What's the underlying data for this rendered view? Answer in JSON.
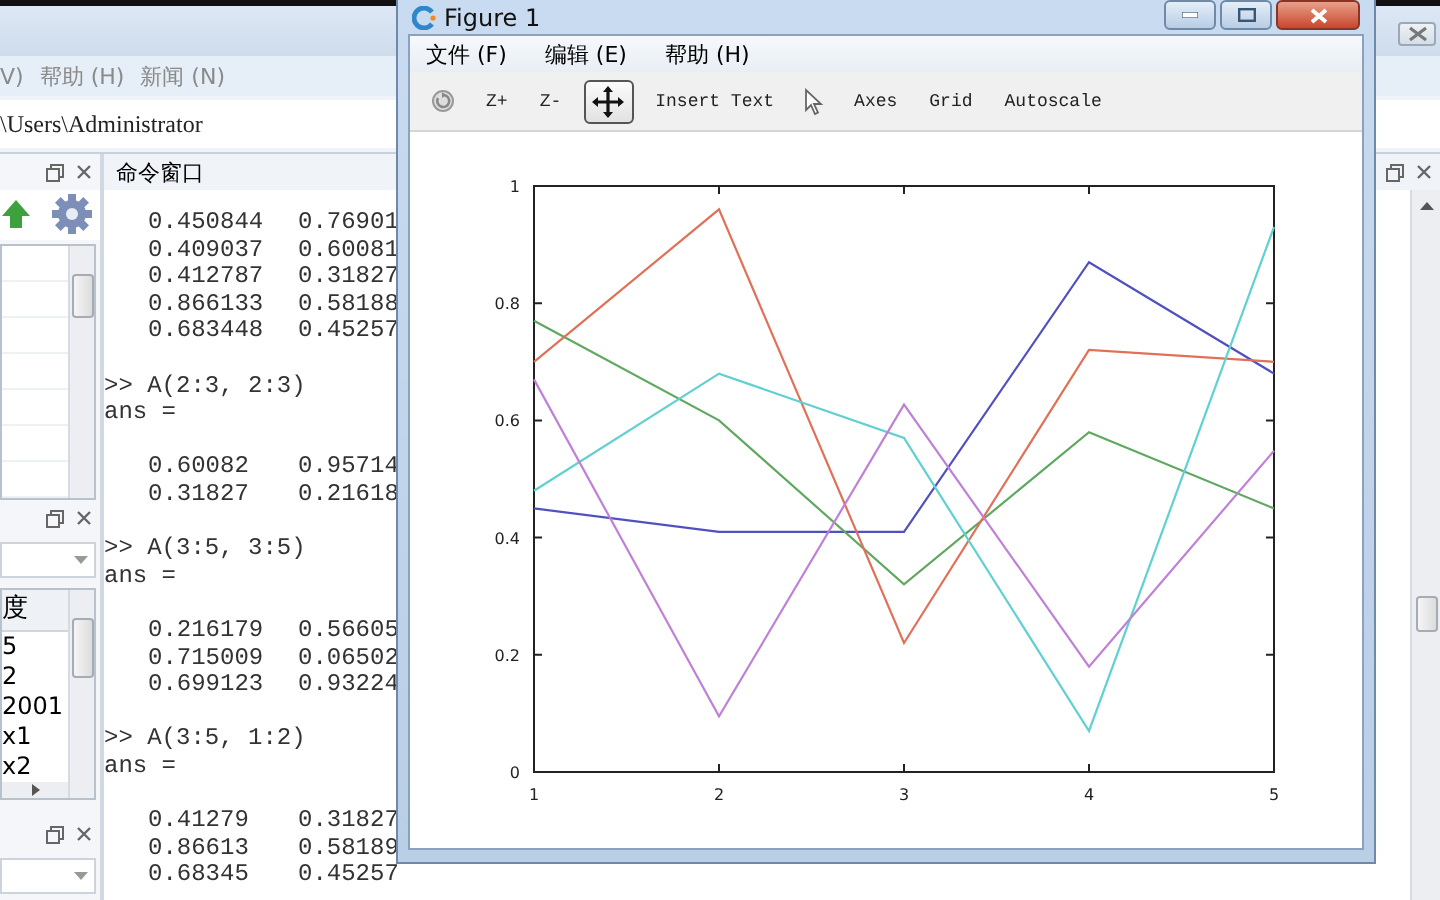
{
  "main_window": {
    "menu": [
      "V)",
      "帮助 (H)",
      "新闻 (N)"
    ],
    "path": "\\Users\\Administrator",
    "variable_table": {
      "header": "度",
      "rows": [
        "5",
        "2",
        "2001",
        "x1",
        "x2"
      ]
    },
    "command_window": {
      "title": "命令窗口",
      "blocks": [
        {
          "rows": [
            [
              "0.450844",
              "0.76901"
            ],
            [
              "0.409037",
              "0.60081"
            ],
            [
              "0.412787",
              "0.31827"
            ],
            [
              "0.866133",
              "0.58188"
            ],
            [
              "0.683448",
              "0.45257"
            ]
          ]
        },
        {
          "prompt": ">> A(2:3, 2:3)",
          "result": "ans =",
          "rows": [
            [
              "0.60082",
              "0.95714"
            ],
            [
              "0.31827",
              "0.21618"
            ]
          ]
        },
        {
          "prompt": ">> A(3:5, 3:5)",
          "result": "ans =",
          "rows": [
            [
              "0.216179",
              "0.56605"
            ],
            [
              "0.715009",
              "0.06502"
            ],
            [
              "0.699123",
              "0.93224"
            ]
          ]
        },
        {
          "prompt": ">> A(3:5, 1:2)",
          "result": "ans =",
          "rows": [
            [
              "0.41279",
              "0.31827"
            ],
            [
              "0.86613",
              "0.58189"
            ],
            [
              "0.68345",
              "0.45257"
            ]
          ]
        }
      ]
    }
  },
  "figure": {
    "title": "Figure 1",
    "menu": [
      "文件 (F)",
      "编辑 (E)",
      "帮助 (H)"
    ],
    "toolbar": [
      {
        "kind": "rotate",
        "selected": false
      },
      {
        "kind": "text",
        "label": "Z+",
        "selected": false
      },
      {
        "kind": "text",
        "label": "Z-",
        "selected": false
      },
      {
        "kind": "pan",
        "selected": true
      },
      {
        "kind": "text",
        "label": "Insert Text",
        "selected": false
      },
      {
        "kind": "select",
        "selected": false
      },
      {
        "kind": "text",
        "label": "Axes",
        "selected": false
      },
      {
        "kind": "text",
        "label": "Grid",
        "selected": false
      },
      {
        "kind": "text",
        "label": "Autoscale",
        "selected": false
      }
    ],
    "chart_data": {
      "type": "line",
      "x": [
        1,
        2,
        3,
        4,
        5
      ],
      "xlim": [
        1,
        5
      ],
      "ylim": [
        0,
        1
      ],
      "xticks": [
        1,
        2,
        3,
        4,
        5
      ],
      "yticks": [
        0,
        0.2,
        0.4,
        0.6,
        0.8,
        1
      ],
      "series": [
        {
          "color": "#5050c0",
          "values": [
            0.45,
            0.41,
            0.41,
            0.87,
            0.68
          ]
        },
        {
          "color": "#60a860",
          "values": [
            0.77,
            0.6,
            0.32,
            0.58,
            0.45
          ]
        },
        {
          "color": "#e07058",
          "values": [
            0.7,
            0.96,
            0.22,
            0.72,
            0.7
          ]
        },
        {
          "color": "#60d0d0",
          "values": [
            0.48,
            0.68,
            0.57,
            0.07,
            0.93
          ]
        },
        {
          "color": "#c080d8",
          "values": [
            0.67,
            0.095,
            0.627,
            0.18,
            0.548
          ]
        }
      ]
    }
  }
}
